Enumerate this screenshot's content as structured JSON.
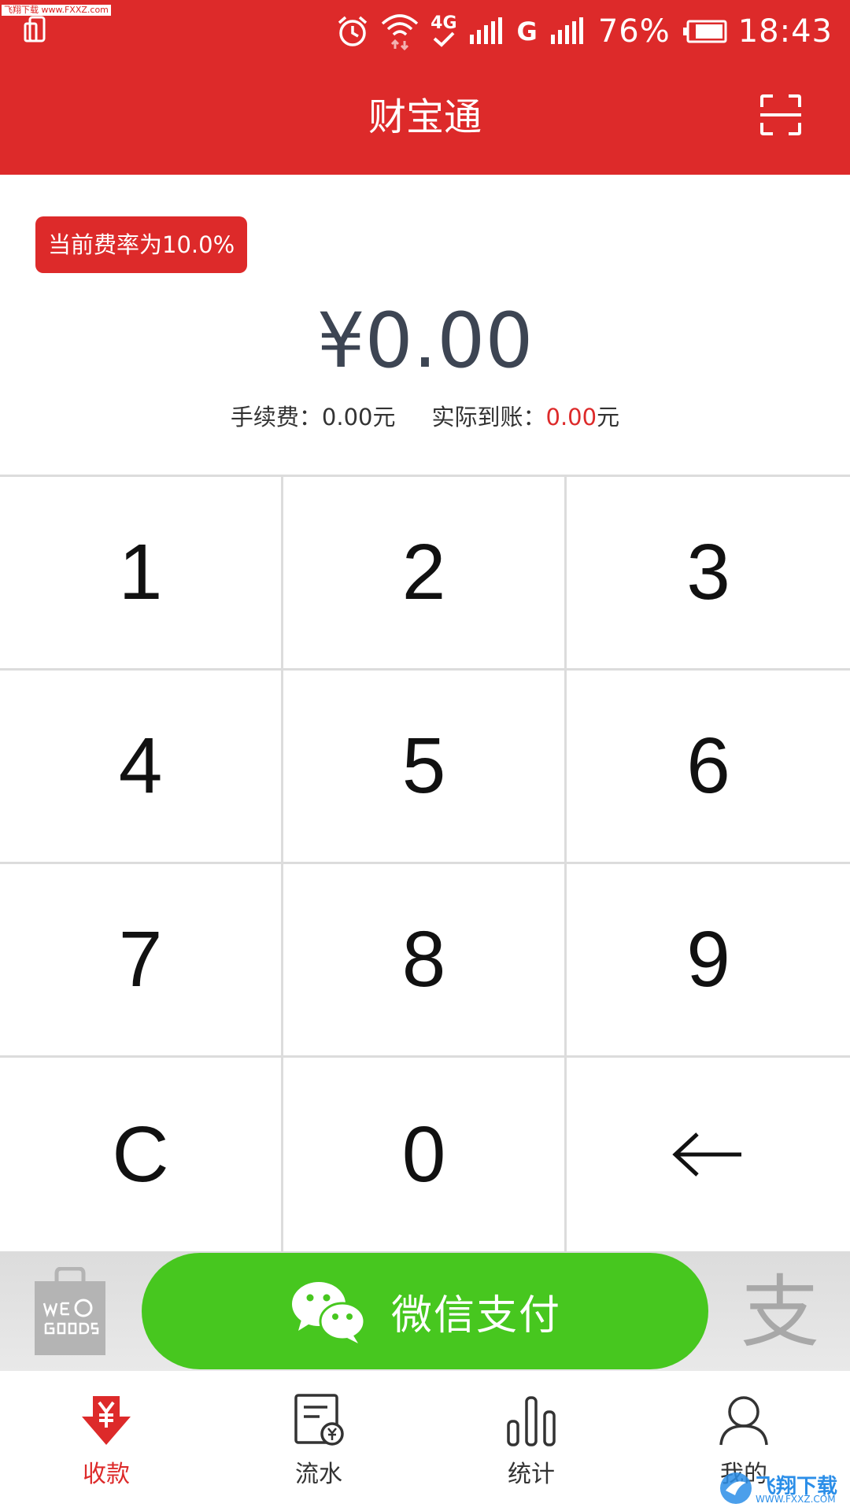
{
  "status_bar": {
    "watermark": "飞翔下载 www.FXXZ.com",
    "network": "4G",
    "g_label": "G",
    "battery": "76%",
    "time": "18:43"
  },
  "header": {
    "title": "财宝通"
  },
  "amount_panel": {
    "fee_rate_badge": "当前费率为10.0%",
    "amount": "¥0.00",
    "fee_label": "手续费：",
    "fee_value": "0.00元",
    "actual_label": "实际到账：",
    "actual_value": "0.00",
    "actual_unit": "元"
  },
  "keypad": {
    "keys": [
      "1",
      "2",
      "3",
      "4",
      "5",
      "6",
      "7",
      "8",
      "9",
      "C",
      "0",
      "←"
    ]
  },
  "payment": {
    "wechat_label": "微信支付",
    "alipay_glyph": "支"
  },
  "bottom_nav": {
    "items": [
      {
        "label": "收款",
        "icon": "yen-down-arrow-icon",
        "active": true
      },
      {
        "label": "流水",
        "icon": "receipt-icon",
        "active": false
      },
      {
        "label": "统计",
        "icon": "bar-chart-icon",
        "active": false
      },
      {
        "label": "我的",
        "icon": "user-icon",
        "active": false
      }
    ]
  },
  "watermark_logo": {
    "text": "飞翔下载",
    "sub": "WWW.FXXZ.COM"
  },
  "colors": {
    "brand_red": "#dd2a2a",
    "wechat_green": "#47c71f",
    "amount_text": "#3d4553"
  }
}
